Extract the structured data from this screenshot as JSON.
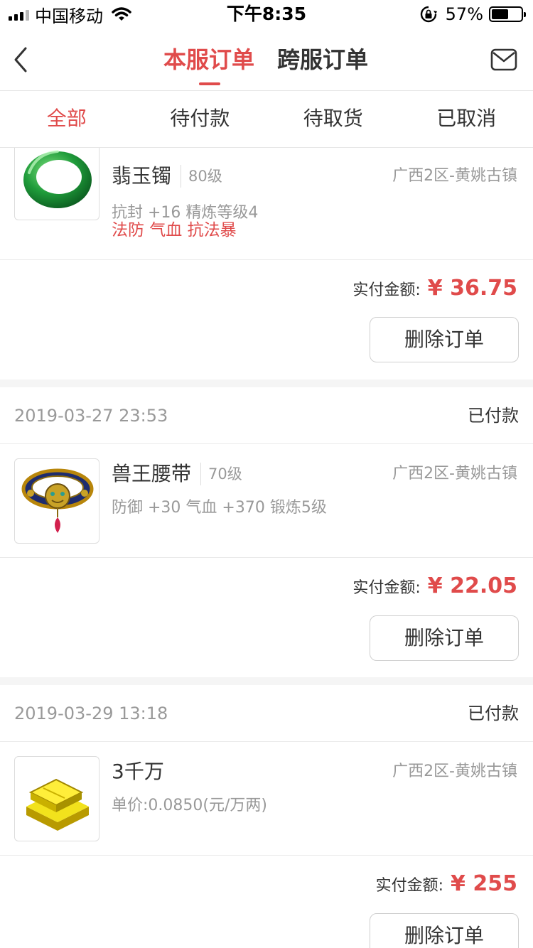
{
  "status_bar": {
    "carrier": "中国移动",
    "time": "下午8:35",
    "battery_percent": "57%",
    "battery_level": 0.57
  },
  "header": {
    "tabs": [
      {
        "label": "本服订单",
        "active": true
      },
      {
        "label": "跨服订单",
        "active": false
      }
    ],
    "back_icon": "chevron-left-icon",
    "mail_icon": "mail-icon"
  },
  "filters": [
    {
      "label": "全部",
      "active": true
    },
    {
      "label": "待付款",
      "active": false
    },
    {
      "label": "待取货",
      "active": false
    },
    {
      "label": "已取消",
      "active": false
    }
  ],
  "accent_color": "#e04b4b",
  "orders": [
    {
      "item_name": "翡玉镯",
      "level": "80级",
      "server": "广西2区-黄姚古镇",
      "attrs": "抗封 +16 精炼等级4",
      "tags": "法防 气血 抗法暴",
      "pay_label": "实付金额:",
      "amount": "¥ 36.75",
      "delete_label": "删除订单",
      "thumb_icon": "jade-bracelet-icon"
    },
    {
      "time": "2019-03-27 23:53",
      "status": "已付款",
      "item_name": "兽王腰带",
      "level": "70级",
      "server": "广西2区-黄姚古镇",
      "attrs": "防御 +30 气血 +370 锻炼5级",
      "pay_label": "实付金额:",
      "amount": "¥ 22.05",
      "delete_label": "删除订单",
      "thumb_icon": "beast-king-belt-icon"
    },
    {
      "time": "2019-03-29 13:18",
      "status": "已付款",
      "item_name": "3千万",
      "server": "广西2区-黄姚古镇",
      "attrs": "单价:0.0850(元/万两)",
      "pay_label": "实付金额:",
      "amount": "¥ 255",
      "delete_label": "删除订单",
      "thumb_icon": "gold-bars-icon"
    }
  ]
}
